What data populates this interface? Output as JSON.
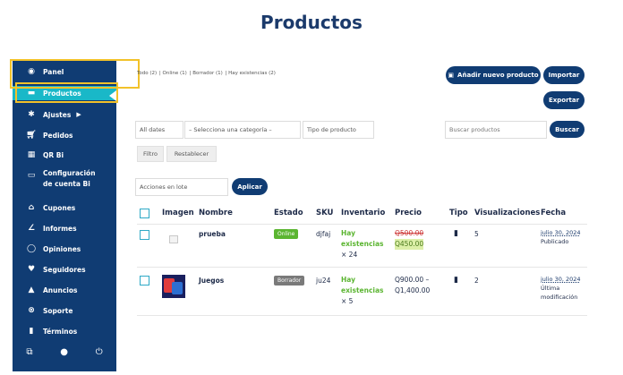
{
  "page": {
    "title": "Productos"
  },
  "sidebar": {
    "items": [
      {
        "label": "Panel",
        "icon": "dashboard-icon"
      },
      {
        "label": "Productos",
        "icon": "box-icon"
      },
      {
        "label": "Ajustes",
        "icon": "gear-icon"
      },
      {
        "label": "Pedidos",
        "icon": "cart-icon"
      },
      {
        "label": "QR Bi",
        "icon": "qr-icon"
      },
      {
        "label": "Configuración de cuenta Bi",
        "icon": "card-icon"
      },
      {
        "label": "Cupones",
        "icon": "gift-icon"
      },
      {
        "label": "Informes",
        "icon": "chart-icon"
      },
      {
        "label": "Opiniones",
        "icon": "chat-icon"
      },
      {
        "label": "Seguidores",
        "icon": "heart-icon"
      },
      {
        "label": "Anuncios",
        "icon": "bell-icon"
      },
      {
        "label": "Soporte",
        "icon": "support-icon"
      },
      {
        "label": "Términos",
        "icon": "document-icon"
      }
    ]
  },
  "filters": {
    "all": "Todo (2)",
    "online": "Online (1)",
    "draft": "Borrador (1)",
    "stock": "Hay existencias (2)",
    "dates": "All dates",
    "category": "– Selecciona una categoría –",
    "type": "Tipo de producto",
    "filter_btn": "Filtro",
    "reset_btn": "Restablecer",
    "bulk": "Acciones en lote",
    "apply_btn": "Aplicar",
    "search_placeholder": "Buscar productos",
    "search_btn": "Buscar"
  },
  "actions": {
    "add": "Añadir nuevo producto",
    "import": "Importar",
    "export": "Exportar"
  },
  "table": {
    "headers": {
      "image": "Imagen",
      "name": "Nombre",
      "status": "Estado",
      "sku": "SKU",
      "inventory": "Inventario",
      "price": "Precio",
      "type": "Tipo",
      "views": "Visualizaciones",
      "date": "Fecha"
    },
    "rows": [
      {
        "name": "prueba",
        "status": "Online",
        "sku": "djfaj",
        "stock_1": "Hay",
        "stock_2": "existencias",
        "stock_qty": "× 24",
        "price_old": "Q500.00",
        "price_new": "Q450.00",
        "views": "5",
        "date": "julio 30, 2024",
        "date_status": "Publicado"
      },
      {
        "name": "Juegos",
        "status": "Borrador",
        "sku": "ju24",
        "stock_1": "Hay",
        "stock_2": "existencias",
        "stock_qty": "× 5",
        "price_1": "Q900.00 –",
        "price_2": "Q1,400.00",
        "views": "2",
        "date": "julio 30, 2024",
        "date_status_1": "Última",
        "date_status_2": "modificación"
      }
    ]
  },
  "colors": {
    "sidebar": "#103c73",
    "active": "#19b8c8",
    "highlight": "#f2c22a",
    "online": "#5bb531",
    "draft": "#7a7a7a"
  }
}
